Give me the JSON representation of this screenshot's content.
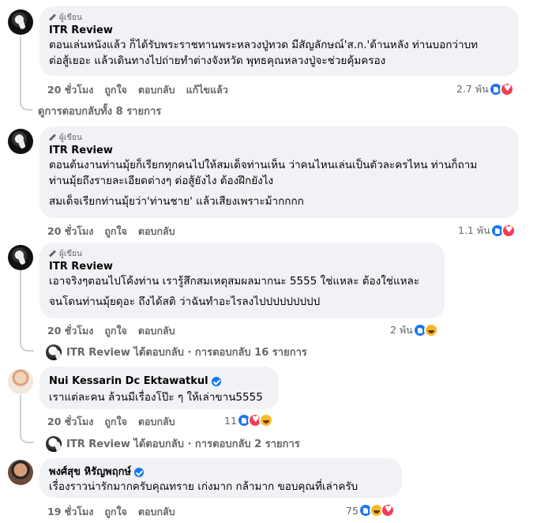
{
  "comments": [
    {
      "tag": "ผู้เขียน",
      "author": "ITR Review",
      "lines": [
        "ตอนเล่นหนังแล้ว ก็ได้รับพระราชทานพระหลวงปู่ทวด มีสัญลักษณ์'ส.ก.'ด้านหลัง ท่านบอกว่าบท",
        "ต่อสู้เยอะ แล้วเดินทางไปถ่ายทำต่างจังหวัด พุทธคุณหลวงปู่จะช่วยคุ้มครอง"
      ],
      "time": "20 ชั่วโมง",
      "like": "ถูกใจ",
      "reply": "ตอบกลับ",
      "edit": "แก้ไขแล้ว",
      "reactions": "2.7 พัน"
    },
    {
      "tag": "ผู้เขียน",
      "author": "ITR Review",
      "lines": [
        "ตอนต้นงานท่านมุ้ยก็เรียกทุกคนไปให้สมเด็จท่านเห็น ว่าคนไหนเล่นเป็นตัวละครไหน ท่านก็ถาม",
        "ท่านมุ้ยถึงรายละเอียดต่างๆ ต่อสู้ยังไง ต้องฝึกยังไง"
      ],
      "lines2": [
        "สมเด็จเรียกท่านมุ้ยว่า'ท่านชาย' แล้วเสียงเพราะม้ากกกก"
      ],
      "time": "20 ชั่วโมง",
      "like": "ถูกใจ",
      "reply": "ตอบกลับ",
      "reactions": "1.1 พัน"
    },
    {
      "tag": "ผู้เขียน",
      "author": "ITR Review",
      "lines": [
        "เอาจริงๆตอนไปโค้งท่าน เรารู้สึกสมเหตุสมผลมากนะ 5555 ใช่แหละ ต้องใช่แหละ"
      ],
      "lines2": [
        "จนโดนท่านมุ้ยดุอะ ถึงได้สติ ว่าฉันทำอะไรลงไปปปปปปปปป"
      ],
      "time": "20 ชั่วโมง",
      "like": "ถูกใจ",
      "reply": "ตอบกลับ",
      "reactions": "2 พัน"
    },
    {
      "author": "Nui Kessarin Dc Ektawatkul",
      "lines": [
        "เราแต่ละคน ล้วนมีเรื่องโป๊ะ ๆ ให้เล่าขาน5555"
      ],
      "time": "20 ชั่วโมง",
      "like": "ถูกใจ",
      "reply": "ตอบกลับ",
      "reactions": "11"
    },
    {
      "author": "พงศ์สุข หิรัญพฤกษ์",
      "lines": [
        "เรื่องราวน่ารักมากครับคุณทราย เก่งมาก กล้ามาก    ขอบคุณที่เล่าครับ"
      ],
      "time": "19 ชั่วโมง",
      "like": "ถูกใจ",
      "reply": "ตอบกลับ",
      "reactions": "75"
    }
  ],
  "view_replies_1": "ดูการตอบกลับทั้ง 8 รายการ",
  "itr_replied_1": "ITR Review ได้ตอบกลับ · การตอบกลับ 16 รายการ",
  "itr_replied_2": "ITR Review ได้ตอบกลับ · การตอบกลับ 2 รายการ",
  "colors": {
    "bubble": "#f0f2f5",
    "secondary": "#65676b",
    "like": "#1877f2",
    "love": "#f33e58",
    "haha": "#f7b928"
  }
}
